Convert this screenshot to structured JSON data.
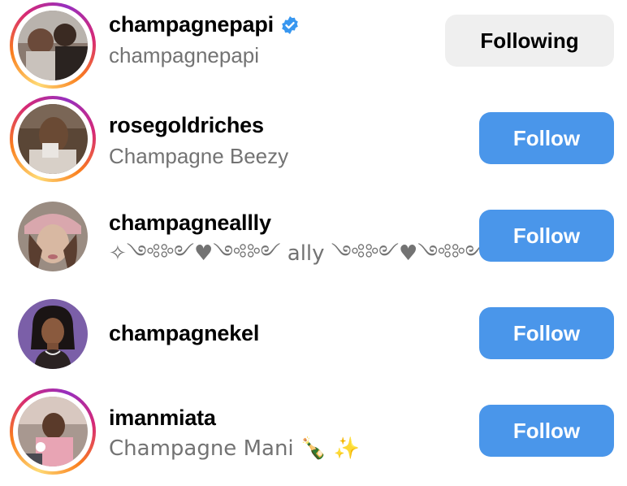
{
  "accounts": [
    {
      "username": "champagnepapi",
      "name": "champagnepapi",
      "verified": true,
      "has_story_ring": true,
      "button": "Following"
    },
    {
      "username": "rosegoldriches",
      "name": "Champagne Beezy",
      "verified": false,
      "has_story_ring": true,
      "button": "Follow"
    },
    {
      "username": "champagneallly",
      "name": "✧༺༻♥༺༻ ally ༺༻♥༺༻✧",
      "verified": false,
      "has_story_ring": false,
      "button": "Follow"
    },
    {
      "username": "champagnekel",
      "name": "",
      "verified": false,
      "has_story_ring": false,
      "button": "Follow"
    },
    {
      "username": "imanmiata",
      "name": "Champagne Mani 🍾 ✨",
      "verified": false,
      "has_story_ring": true,
      "button": "Follow"
    }
  ],
  "colors": {
    "follow_button": "#4a96ea",
    "following_button": "#efefef",
    "verified_badge": "#3897f0",
    "secondary_text": "#737373"
  },
  "icons": {
    "verified": "verified-badge-icon"
  }
}
